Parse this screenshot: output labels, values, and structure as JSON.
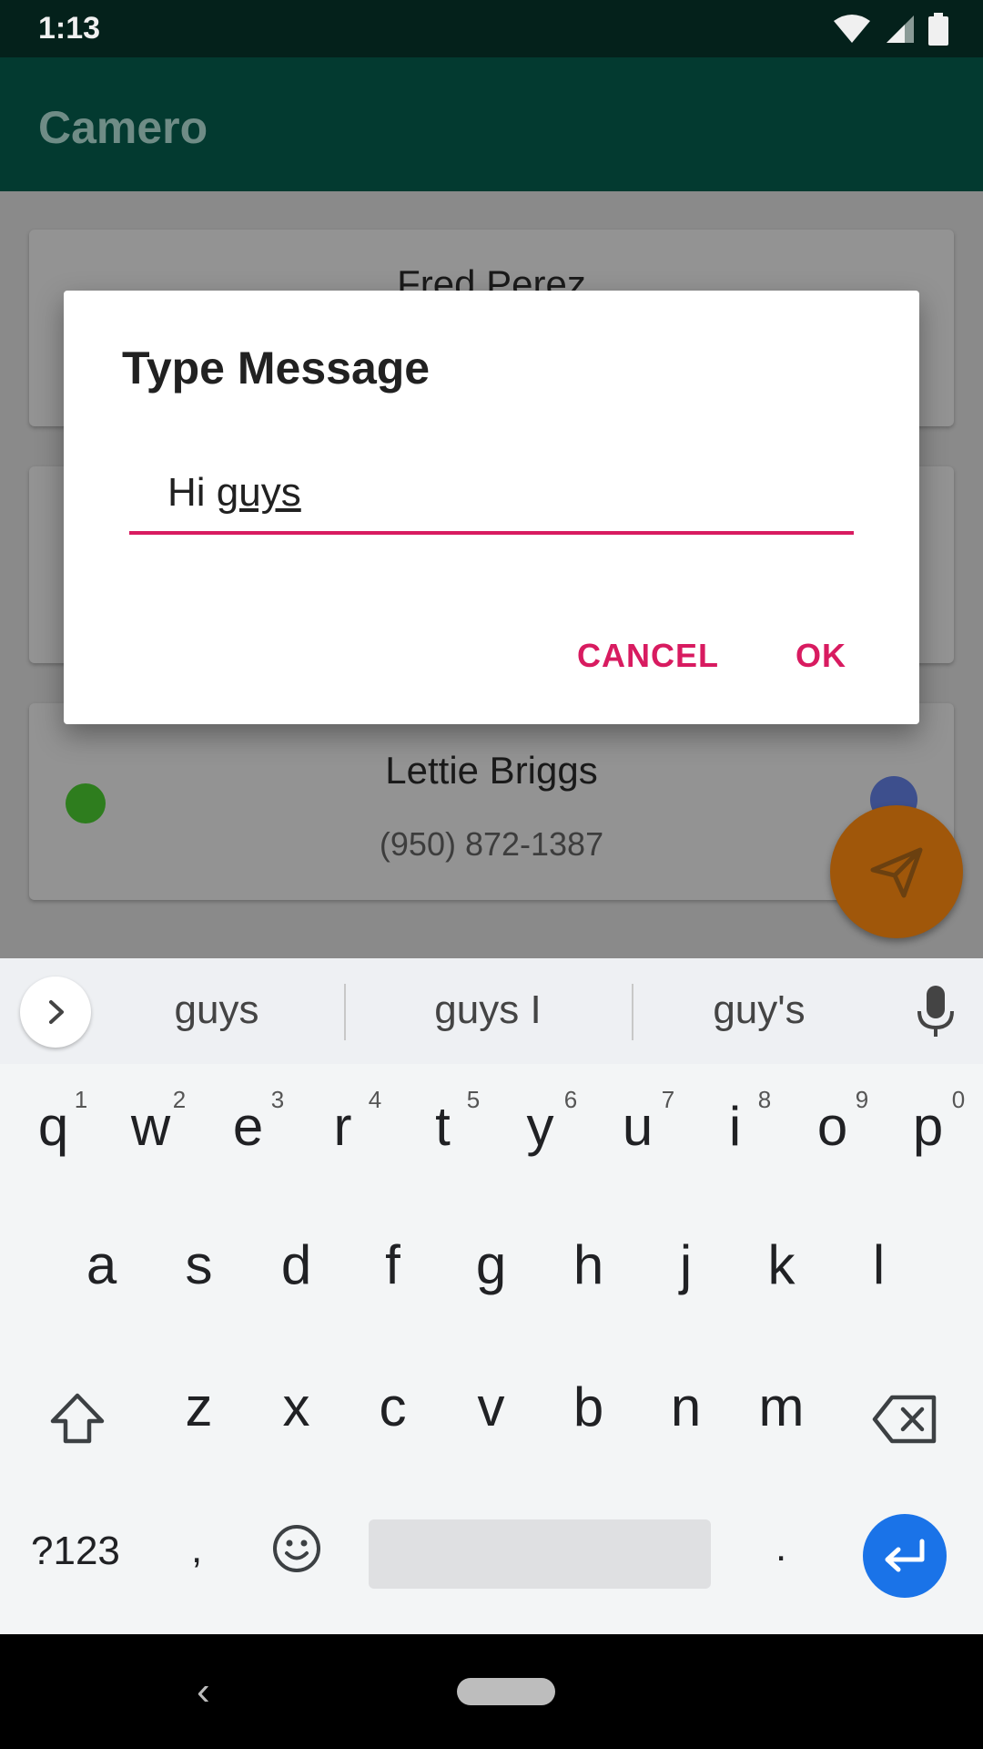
{
  "status_bar": {
    "time": "1:13"
  },
  "app_bar": {
    "title": "Camero"
  },
  "contacts": [
    {
      "name": "Fred Perez",
      "phone": ""
    },
    {
      "name": "",
      "phone": ""
    },
    {
      "name": "Lettie Briggs",
      "phone": "(950) 872-1387"
    }
  ],
  "dialog": {
    "title": "Type Message",
    "input_prefix": "Hi ",
    "input_word": "guys",
    "cancel_label": "CANCEL",
    "ok_label": "OK"
  },
  "keyboard": {
    "suggestions": [
      "guys",
      "guys I",
      "guy's"
    ],
    "row1": [
      "q",
      "w",
      "e",
      "r",
      "t",
      "y",
      "u",
      "i",
      "o",
      "p"
    ],
    "row1_nums": [
      "1",
      "2",
      "3",
      "4",
      "5",
      "6",
      "7",
      "8",
      "9",
      "0"
    ],
    "row2": [
      "a",
      "s",
      "d",
      "f",
      "g",
      "h",
      "j",
      "k",
      "l"
    ],
    "row3": [
      "z",
      "x",
      "c",
      "v",
      "b",
      "n",
      "m"
    ],
    "symbols_label": "?123",
    "comma_label": ",",
    "period_label": "."
  },
  "colors": {
    "accent": "#d81b60",
    "app_bar": "#033a30",
    "fab": "#a0570a",
    "enter": "#1a73e8"
  }
}
